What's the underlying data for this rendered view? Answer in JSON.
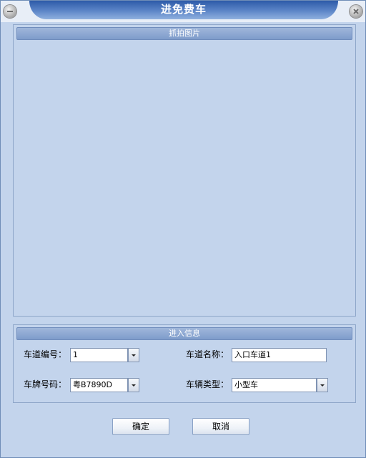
{
  "window": {
    "title": "进免费车"
  },
  "photo_panel": {
    "header": "抓拍图片"
  },
  "info_panel": {
    "header": "进入信息",
    "lane_number": {
      "label": "车道编号：",
      "value": "1"
    },
    "lane_name": {
      "label": "车道名称：",
      "value": "入口车道1"
    },
    "plate_number": {
      "label": "车牌号码：",
      "value": "粤B7890D"
    },
    "vehicle_type": {
      "label": "车辆类型：",
      "value": "小型车"
    }
  },
  "buttons": {
    "ok": "确定",
    "cancel": "取消"
  },
  "icons": {
    "left": "minimize-icon",
    "right": "close-icon"
  }
}
